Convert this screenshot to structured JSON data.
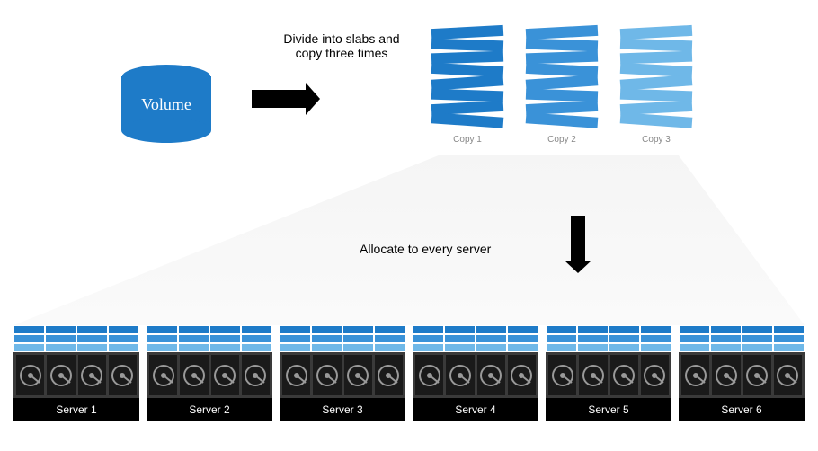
{
  "volume_label": "Volume",
  "caption_divide": "Divide into slabs and copy three times",
  "caption_allocate": "Allocate to every server",
  "copies": [
    {
      "label": "Copy 1",
      "color": "#1e7bc8"
    },
    {
      "label": "Copy 2",
      "color": "#3a92d8"
    },
    {
      "label": "Copy 3",
      "color": "#6fb8e8"
    }
  ],
  "slabs_per_stack": 8,
  "rotations": [
    -3,
    2,
    -2,
    3,
    -4,
    2,
    -3,
    4
  ],
  "servers": [
    {
      "label": "Server 1"
    },
    {
      "label": "Server 2"
    },
    {
      "label": "Server 3"
    },
    {
      "label": "Server 4"
    },
    {
      "label": "Server 5"
    },
    {
      "label": "Server 6"
    }
  ],
  "drives_per_server": 4,
  "slab_colors": [
    "#1e7bc8",
    "#3a92d8",
    "#6fb8e8"
  ],
  "volume_color": "#1e7bc8"
}
